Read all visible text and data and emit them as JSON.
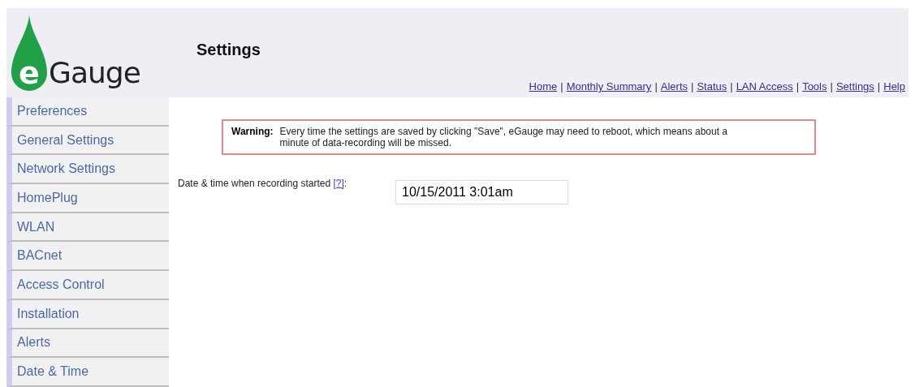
{
  "logo": {
    "mark": "e",
    "wordmark": "Gauge"
  },
  "page_title": "Settings",
  "nav": [
    {
      "kind": "link",
      "label": "Home"
    },
    {
      "kind": "separator",
      "label": "|"
    },
    {
      "kind": "link",
      "label": "Monthly Summary"
    },
    {
      "kind": "separator",
      "label": "|"
    },
    {
      "kind": "link",
      "label": "Alerts"
    },
    {
      "kind": "separator",
      "label": "|"
    },
    {
      "kind": "link",
      "label": "Status"
    },
    {
      "kind": "separator",
      "label": "|"
    },
    {
      "kind": "link",
      "label": "LAN Access"
    },
    {
      "kind": "separator",
      "label": "|"
    },
    {
      "kind": "link",
      "label": "Tools"
    },
    {
      "kind": "separator",
      "label": "|"
    },
    {
      "kind": "link",
      "label": "Settings"
    },
    {
      "kind": "separator",
      "label": "|"
    },
    {
      "kind": "link",
      "label": "Help"
    }
  ],
  "sidebar": {
    "items": [
      {
        "label": "Preferences"
      },
      {
        "label": "General Settings"
      },
      {
        "label": "Network Settings"
      },
      {
        "label": "HomePlug"
      },
      {
        "label": "WLAN"
      },
      {
        "label": "BACnet"
      },
      {
        "label": "Access Control"
      },
      {
        "label": "Installation"
      },
      {
        "label": "Alerts"
      },
      {
        "label": "Date & Time"
      }
    ]
  },
  "warning": {
    "label": "Warning:",
    "message": "Every time the settings are saved by clicking \"Save\", eGauge may need to reboot, which means about a minute of data-recording will be missed."
  },
  "fields": [
    {
      "label": "Date & time when recording started",
      "help_link": "[?]",
      "suffix": ":",
      "value": "10/15/2011 3:01am"
    }
  ]
}
